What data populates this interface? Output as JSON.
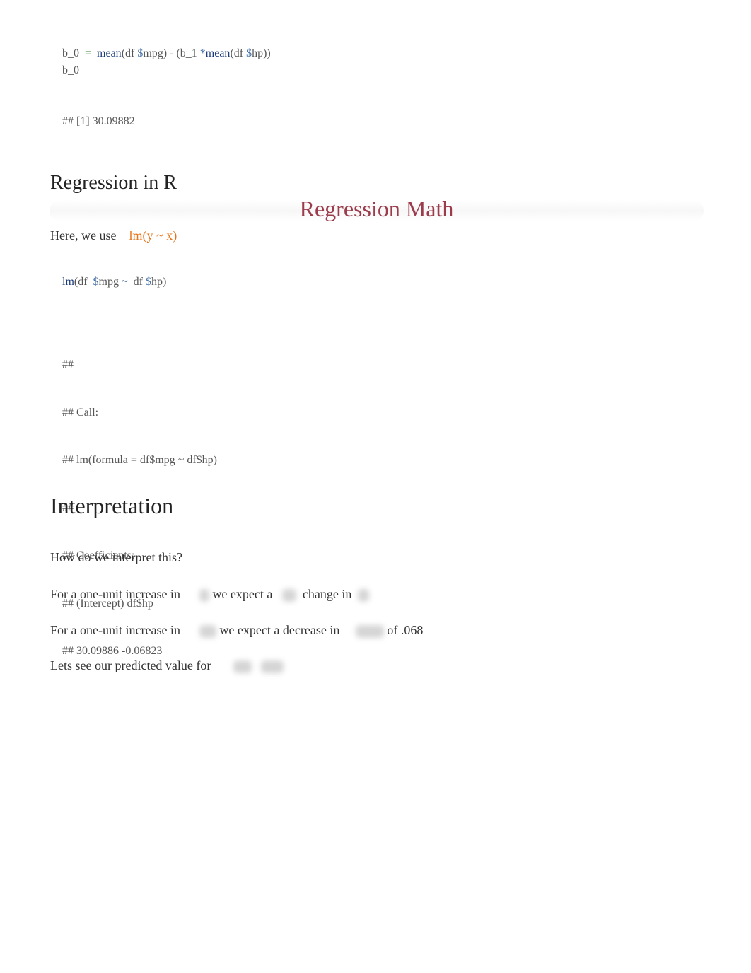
{
  "code_block_1": {
    "line1": {
      "lhs": "b_0",
      "assign": "=",
      "fn1": "mean",
      "p1": "(df ",
      "d1": "$",
      "v1": "mpg",
      "p2": ") - (b_1 ",
      "mul": "*",
      "fn2": "mean",
      "p3": "(df ",
      "d2": "$",
      "v2": "hp))"
    },
    "line2": "b_0"
  },
  "output_1": "## [1] 30.09882",
  "section_regression_in_r": {
    "heading": "Regression in R",
    "banner_title": "Regression Math",
    "intro_text": "Here, we use",
    "intro_code": "lm(y ~ x)"
  },
  "code_block_2": {
    "fn": "lm",
    "p1": "(df ",
    "d1": "$",
    "v1": "mpg",
    "tilde": " ~ ",
    "p2": " df ",
    "d2": "$",
    "v2": "hp)"
  },
  "output_2": [
    "##",
    "## Call:",
    "## lm(formula = df$mpg ~ df$hp)",
    "##",
    "## Coefficients:",
    "## (Intercept) df$hp",
    "## 30.09886 -0.06823"
  ],
  "section_interpretation": {
    "heading": "Interpretation",
    "question": "How do we interpret this?",
    "sentence1": {
      "a": "For a one-unit increase in",
      "b": "we expect a",
      "c": "change in"
    },
    "sentence2": {
      "a": "For a one-unit increase in",
      "b": "we expect a decrease in",
      "c": "of .068"
    },
    "sentence3": {
      "a": "Lets see our predicted value for"
    }
  }
}
